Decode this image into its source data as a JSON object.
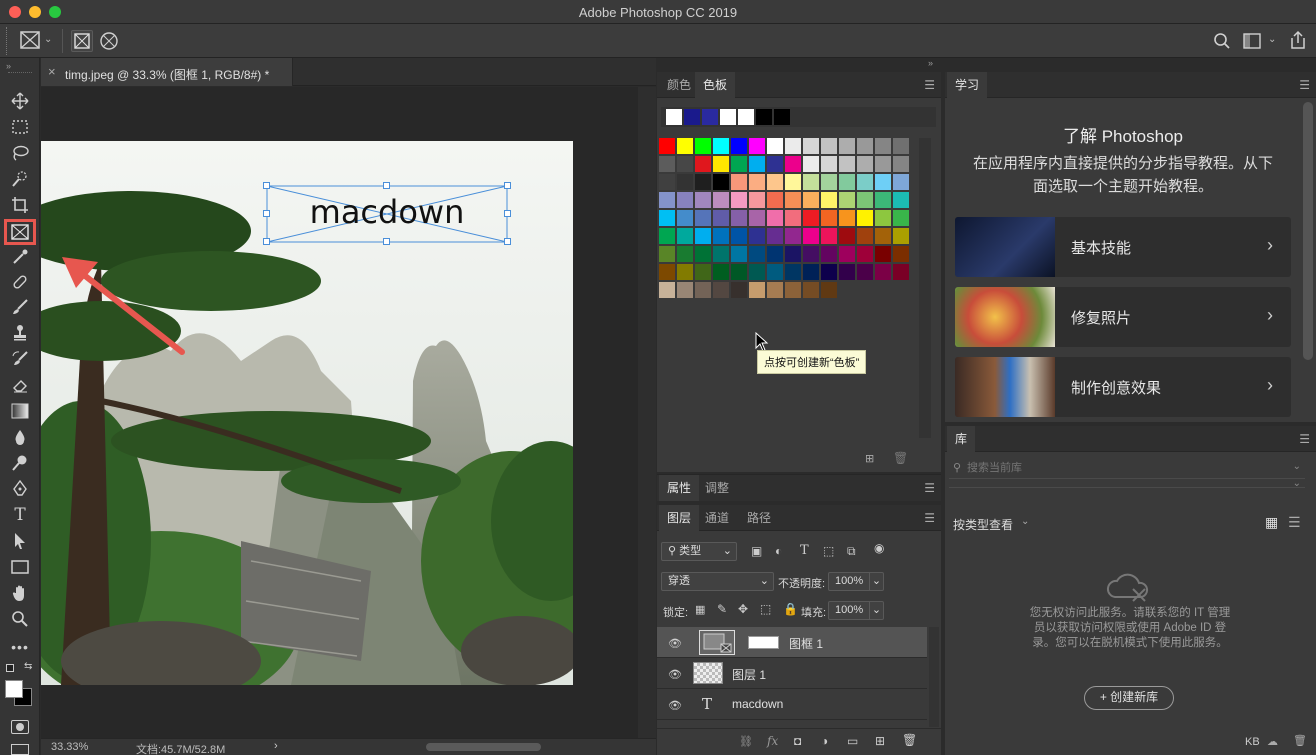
{
  "window": {
    "title": "Adobe Photoshop CC 2019"
  },
  "document": {
    "tab_title": "timg.jpeg @ 33.3% (图框 1, RGB/8#) *",
    "tab_close": "×",
    "frame_text": "macdown",
    "zoom": "33.33%",
    "doc_size": "文档:45.7M/52.8M",
    "status_arrow": "›"
  },
  "swatches_panel": {
    "tabs": [
      "颜色",
      "色板"
    ],
    "active_tab": "色板",
    "recent": [
      "#ffffff",
      "#1a1a8c",
      "#2a2aa0",
      "#ffffff",
      "#ffffff",
      "#000000",
      "#000000"
    ],
    "tooltip": "点按可创建新“色板”",
    "rows": [
      [
        "#ff0000",
        "#ffff00",
        "#00ff00",
        "#00ffff",
        "#0000ff",
        "#ff00ff",
        "#ffffff",
        "#ebebeb",
        "#d6d6d6",
        "#c2c2c2",
        "#adadad",
        "#999999",
        "#858585",
        "#707070"
      ],
      [
        "#5c5c5c",
        "#474747",
        "#e0171d",
        "#ffe600",
        "#00a651",
        "#00aeef",
        "#2e3192",
        "#ec008c",
        "#ebebeb",
        "#d6d6d6",
        "#c2c2c2",
        "#adadad",
        "#999999",
        "#858585"
      ],
      [
        "#404040",
        "#333333",
        "#1f1f1f",
        "#000000",
        "#f7977a",
        "#fbad82",
        "#fdc68c",
        "#fff79a",
        "#c4df9b",
        "#a3d39c",
        "#82ca9d",
        "#7bcdc8",
        "#6ecff6",
        "#7ea7d8"
      ],
      [
        "#8493ca",
        "#8882be",
        "#a187be",
        "#bc8dbf",
        "#f49ac2",
        "#f6989d",
        "#f26c4f",
        "#f68e56",
        "#fbaf5d",
        "#fff468",
        "#acd373",
        "#7cc576",
        "#3cb878",
        "#1cbbb4"
      ],
      [
        "#00bff3",
        "#448ccb",
        "#5574b9",
        "#605ca8",
        "#8560a8",
        "#a864a8",
        "#f06eaa",
        "#f26d7d",
        "#ed1c24",
        "#f26522",
        "#f7941d",
        "#fff200",
        "#8dc73f",
        "#39b54a"
      ],
      [
        "#00a651",
        "#00a99d",
        "#00aeef",
        "#0072bc",
        "#0054a6",
        "#2e3192",
        "#662d91",
        "#92278f",
        "#ec008c",
        "#ed145b",
        "#9e0b0f",
        "#a0410d",
        "#a36209",
        "#aba000"
      ],
      [
        "#598527",
        "#197b30",
        "#007236",
        "#00746b",
        "#0076a3",
        "#004a80",
        "#003471",
        "#1b1464",
        "#440e62",
        "#630460",
        "#9e005d",
        "#9e0039",
        "#790000",
        "#7b2e00"
      ],
      [
        "#7d4900",
        "#827b00",
        "#406618",
        "#005e20",
        "#005826",
        "#005952",
        "#005b7f",
        "#003663",
        "#002157",
        "#0d004c",
        "#32004b",
        "#4b0049",
        "#7b0046",
        "#7a0026"
      ],
      [
        "#c7b299",
        "#998675",
        "#736357",
        "#534741",
        "#37302d",
        "#c69c6d",
        "#a67c52",
        "#8c6239",
        "#754c24",
        "#603913"
      ]
    ]
  },
  "learn_panel": {
    "tab": "学习",
    "heading": "了解 Photoshop",
    "description": "在应用程序内直接提供的分步指导教程。从下面选取一个主题开始教程。",
    "cards": [
      {
        "label": "基本技能",
        "chevron": "›"
      },
      {
        "label": "修复照片",
        "chevron": "›"
      },
      {
        "label": "制作创意效果",
        "chevron": "›"
      }
    ]
  },
  "library_panel": {
    "tab": "库",
    "search_placeholder": "搜索当前库",
    "view_by": "按类型查看",
    "message": "您无权访问此服务。请联系您的 IT 管理员以获取访问权限或使用 Adobe ID 登录。您可以在脱机模式下使用此服务。",
    "create_button": "+ 创建新库",
    "footer_kb": "KB"
  },
  "properties_panel": {
    "tabs": [
      "属性",
      "调整"
    ],
    "active_tab": "属性"
  },
  "layers_panel": {
    "tabs": [
      "图层",
      "通道",
      "路径"
    ],
    "active_tab": "图层",
    "filter_label": "类型",
    "blend_mode": "穿透",
    "opacity_label": "不透明度:",
    "opacity_value": "100%",
    "lock_label": "锁定:",
    "fill_label": "填充:",
    "fill_value": "100%",
    "layers": [
      {
        "name": "图框 1",
        "type": "frame",
        "selected": true
      },
      {
        "name": "图层 1",
        "type": "pixel",
        "selected": false
      },
      {
        "name": "macdown",
        "type": "text",
        "selected": false
      }
    ]
  },
  "colors": {
    "accent_red": "#e7574f",
    "frame_blue": "#4a8fd9",
    "panel_bg": "#3a3a3a"
  }
}
